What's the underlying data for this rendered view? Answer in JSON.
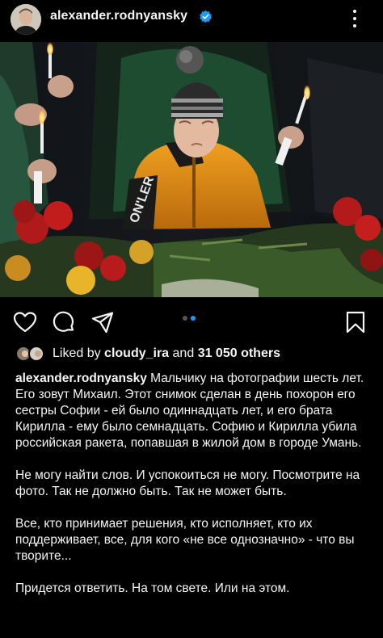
{
  "post": {
    "username": "alexander.rodnyansky",
    "verified": true
  },
  "carousel": {
    "count": 2,
    "active": 2
  },
  "likes": {
    "prefix": "Liked by",
    "user": "cloudy_ira",
    "middle": "and",
    "count": "31 050 others"
  },
  "caption": {
    "username": "alexander.rodnyansky",
    "para1": "Мальчику на фотографии шесть лет. Его зовут Михаил. Этот снимок сделан в день похорон его сестры Софии - ей было одиннадцать лет, и его брата Кирилла - ему было семнадцать. Софию и Кирилла убила российская ракета, попавшая в жилой дом в городе Умань.",
    "para2": "Не могу найти слов. И успокоиться не могу. Посмотрите на фото. Так не должно быть. Так не может быть.",
    "para3": "Все, кто принимает решения, кто исполняет, кто их поддерживает, все, для кого «не все однозначно» - что вы творите...",
    "para4": "Придется ответить. На том свете. Или на этом."
  },
  "photo_text": {
    "jacket_print": "ON'LER"
  },
  "icons": [
    "avatar",
    "verified-badge-icon",
    "more-options-icon",
    "heart-icon",
    "comment-icon",
    "share-icon",
    "bookmark-icon"
  ],
  "colors": {
    "background": "#000000",
    "text": "#f5f5f5",
    "verified": "#1d9bf0",
    "active_dot": "#1d9bf0"
  }
}
